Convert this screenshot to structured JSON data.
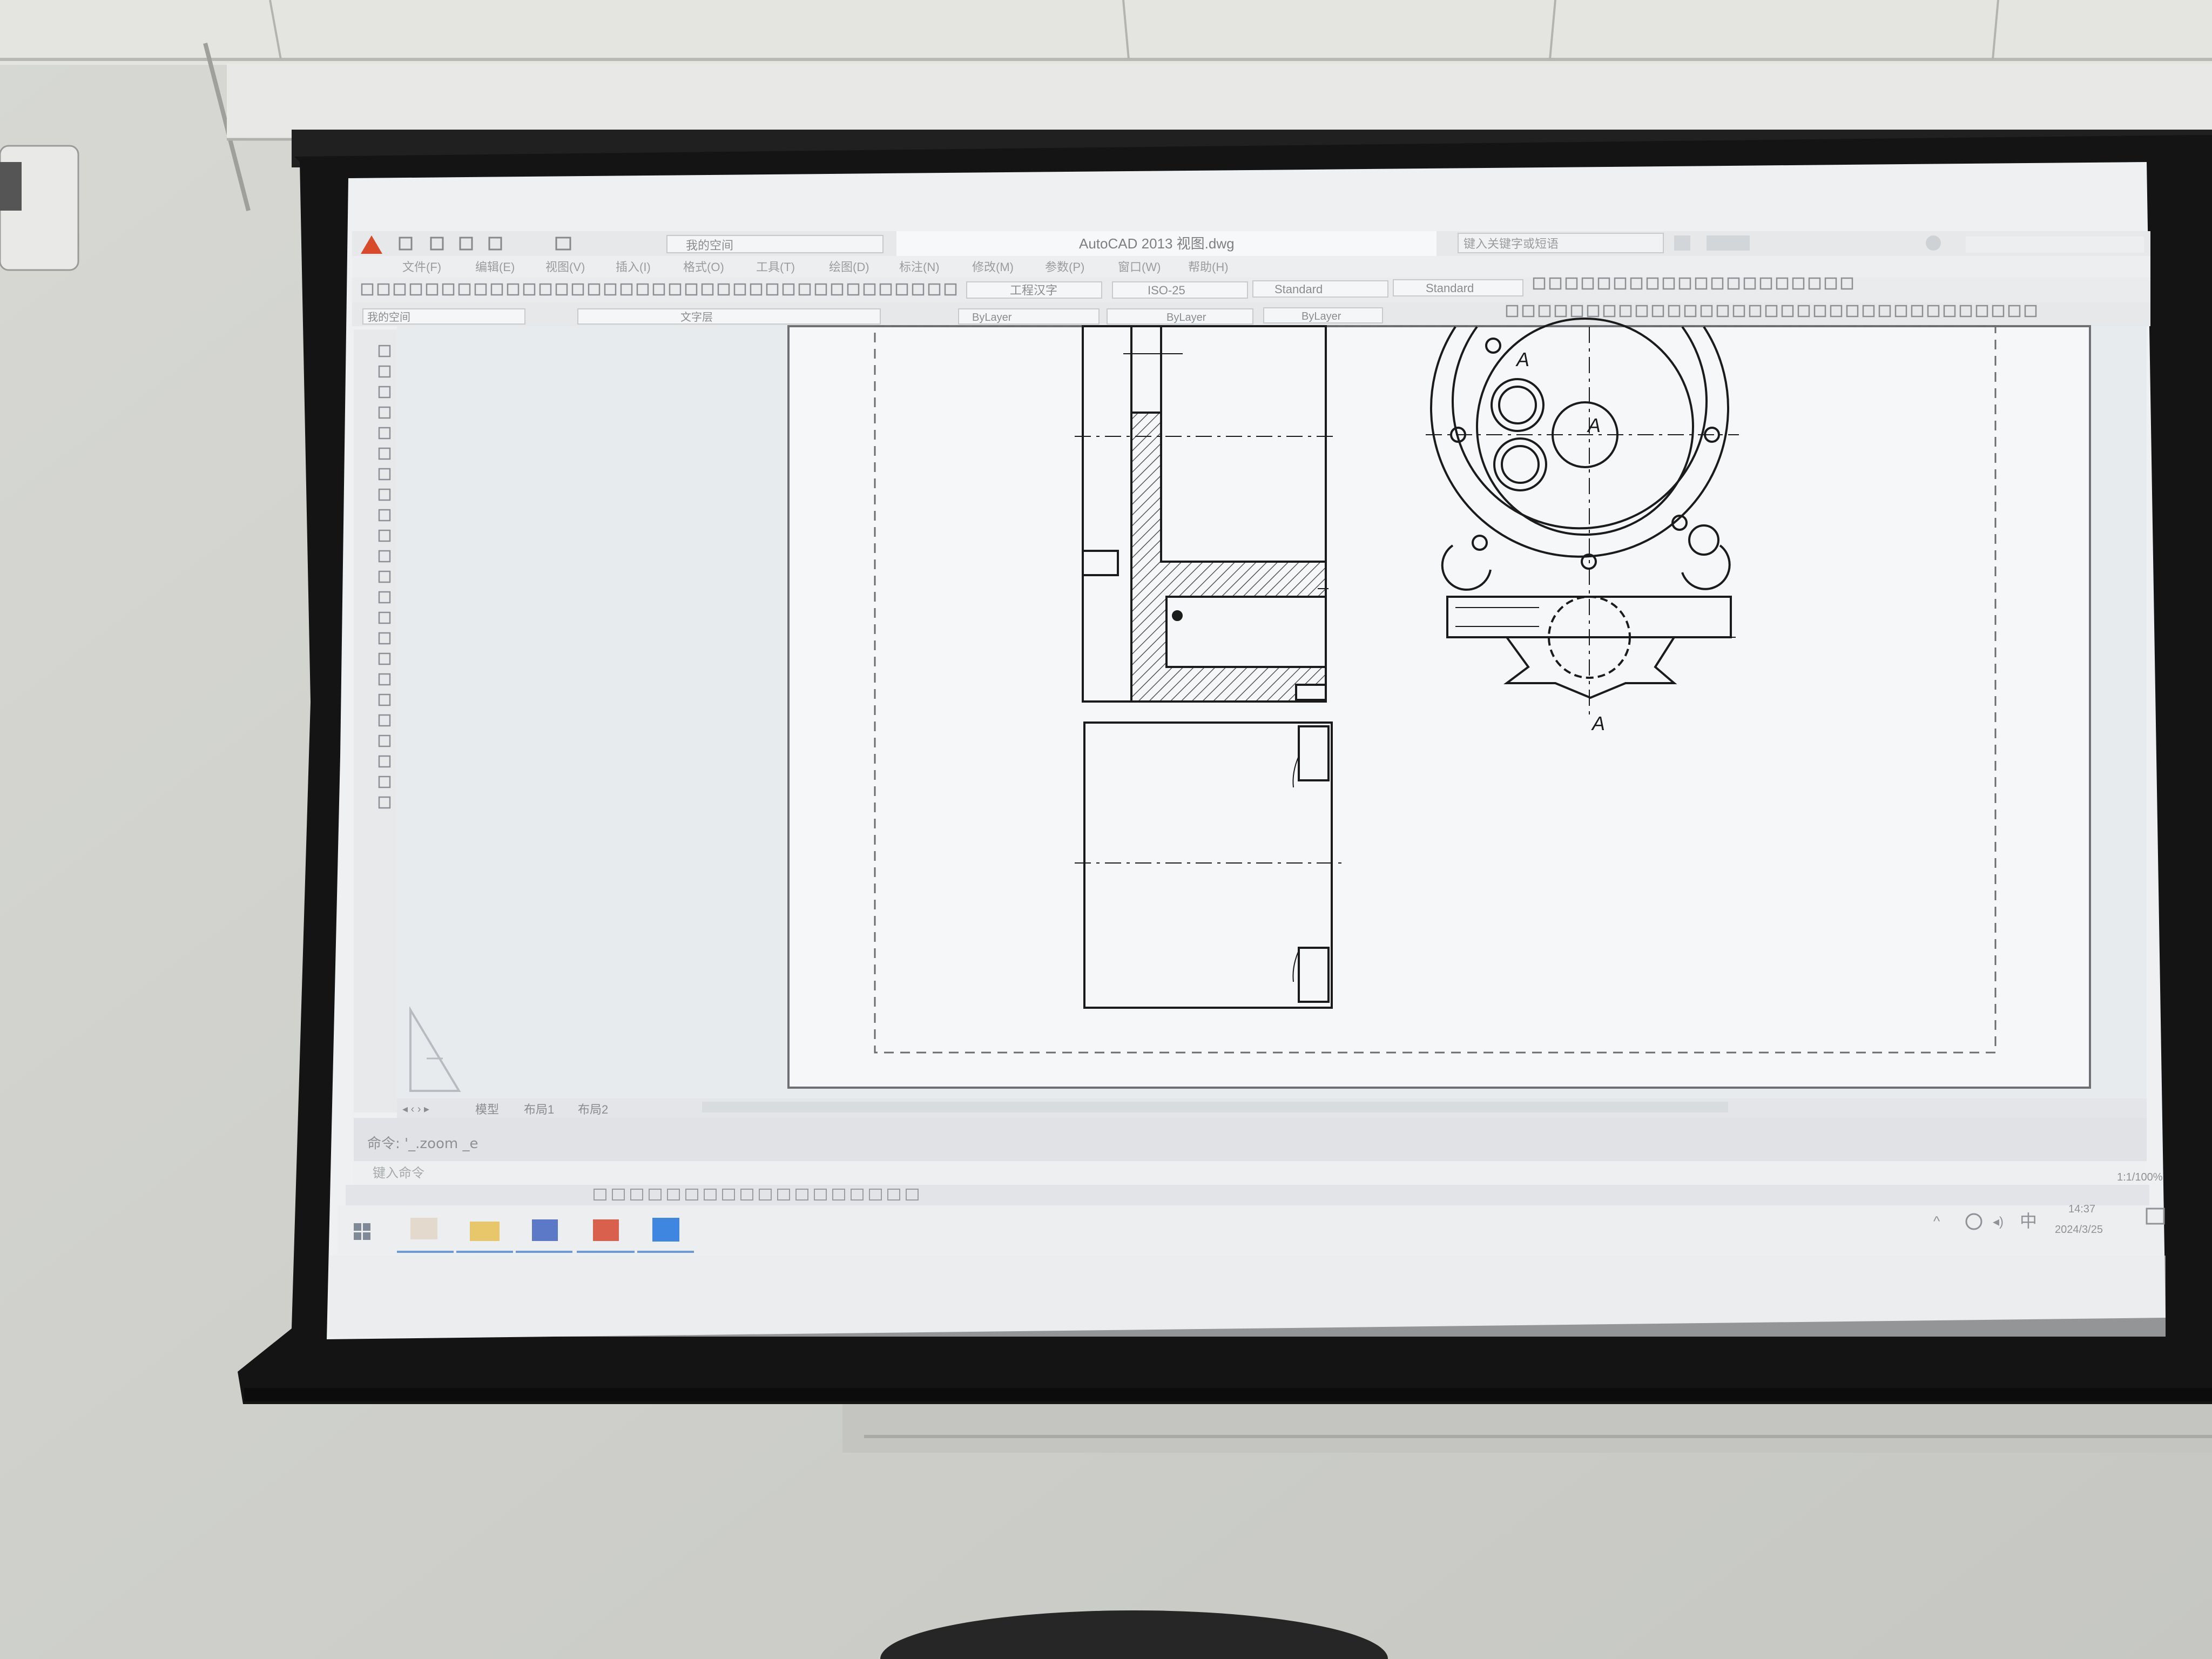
{
  "app": {
    "title": "AutoCAD 2013   视图.dwg",
    "workspace": "我的空间",
    "search_placeholder": "键入关键字或短语",
    "menus": [
      "文件(F)",
      "编辑(E)",
      "视图(V)",
      "插入(I)",
      "格式(O)",
      "工具(T)",
      "绘图(D)",
      "标注(N)",
      "修改(M)",
      "参数(P)",
      "窗口(W)",
      "帮助(H)"
    ]
  },
  "toolbar": {
    "text_style": "工程汉字",
    "dim_style": "ISO-25",
    "table_style": "Standard",
    "mleader_style": "Standard",
    "layer_combo": "我的空间",
    "text_combo": "文字层",
    "color": "ByLayer",
    "linetype": "ByLayer",
    "lineweight": "ByLayer"
  },
  "drawing": {
    "section_label_top": "A",
    "section_label_center": "A",
    "section_label_bottom": "A"
  },
  "tabs": [
    "模型",
    "布局1",
    "布局2"
  ],
  "command": {
    "history": "命令: '_.zoom _e",
    "prompt": "键入命令"
  },
  "status": {
    "right_text": "1:1/100%"
  },
  "taskbar": {
    "ime": "中",
    "time": "14:37",
    "date": "2024/3/25"
  },
  "colors": {
    "wall": "#cfd0cc",
    "screen_frame": "#141414",
    "screen": "#eef0f2",
    "accent_red": "#d94a2b",
    "drawing_line": "#1b1b1b"
  }
}
